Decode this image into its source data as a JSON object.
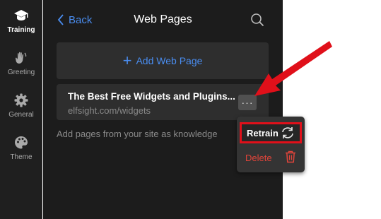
{
  "sidebar": {
    "items": [
      {
        "label": "Training",
        "icon": "graduation-cap-icon",
        "active": true
      },
      {
        "label": "Greeting",
        "icon": "waving-hand-icon",
        "active": false
      },
      {
        "label": "General",
        "icon": "gear-icon",
        "active": false
      },
      {
        "label": "Theme",
        "icon": "palette-icon",
        "active": false
      }
    ]
  },
  "header": {
    "back_label": "Back",
    "title": "Web Pages"
  },
  "add_button": {
    "label": "Add Web Page"
  },
  "pages": [
    {
      "title": "The Best Free Widgets and Plugins...",
      "url": "elfsight.com/widgets"
    }
  ],
  "hint": "Add pages from your site as knowledge",
  "menu": {
    "retrain_label": "Retrain",
    "delete_label": "Delete"
  },
  "colors": {
    "accent": "#4a8df0",
    "panel_bg": "#1c1c1c",
    "card_bg": "#2e2e2e",
    "danger": "#e0443a",
    "annotation": "#e0101a"
  }
}
